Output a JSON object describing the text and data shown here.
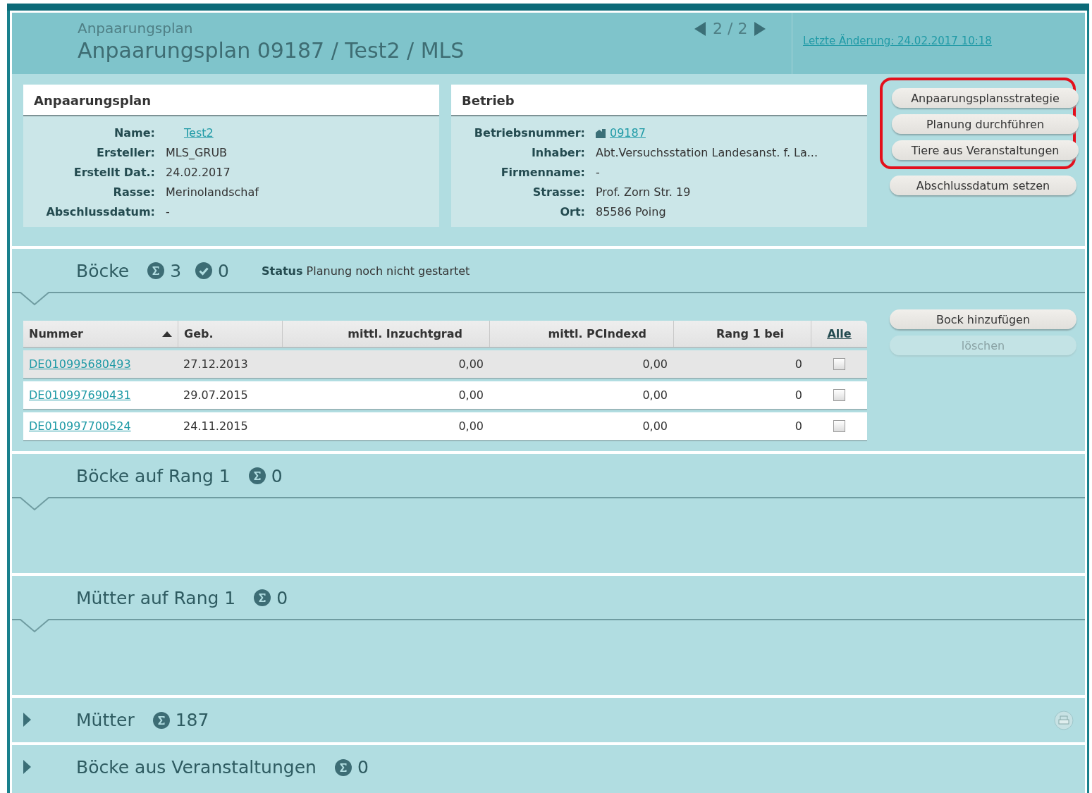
{
  "header": {
    "subtitle": "Anpaarungsplan",
    "title": "Anpaarungsplan 09187 / Test2 / MLS",
    "pager": "2 / 2",
    "last_change": "Letzte Änderung: 24.02.2017 10:18"
  },
  "cards": [
    {
      "title": "Anpaarungsplan",
      "fields": [
        {
          "label": "Name:",
          "value": "Test2",
          "kind": "link"
        },
        {
          "label": "Ersteller:",
          "value": "MLS_GRUB",
          "kind": "text"
        },
        {
          "label": "Erstellt Dat.:",
          "value": "24.02.2017",
          "kind": "text"
        },
        {
          "label": "Rasse:",
          "value": "Merinolandschaf",
          "kind": "text"
        },
        {
          "label": "Abschlussdatum:",
          "value": "-",
          "kind": "text"
        }
      ]
    },
    {
      "title": "Betrieb",
      "fields": [
        {
          "label": "Betriebsnummer:",
          "value": "09187",
          "kind": "farm_link"
        },
        {
          "label": "Inhaber:",
          "value": "Abt.Versuchsstation Landesanst. f. La...",
          "kind": "text"
        },
        {
          "label": "Firmenname:",
          "value": "-",
          "kind": "text"
        },
        {
          "label": "Strasse:",
          "value": "Prof. Zorn Str. 19",
          "kind": "text"
        },
        {
          "label": "Ort:",
          "value": "85586 Poing",
          "kind": "text"
        }
      ]
    }
  ],
  "actions": [
    {
      "label": "Anpaarungsplansstrategie",
      "highlighted": true,
      "disabled": false
    },
    {
      "label": "Planung durchführen",
      "highlighted": true,
      "disabled": false
    },
    {
      "label": "Tiere aus Veranstaltungen",
      "highlighted": true,
      "disabled": false
    },
    {
      "label": "Abschlussdatum setzen",
      "highlighted": false,
      "disabled": false
    }
  ],
  "sections": [
    {
      "title": "Böcke",
      "expanded": true,
      "printable": false,
      "counts": [
        {
          "kind": "total",
          "value": "3"
        },
        {
          "kind": "done",
          "value": "0"
        }
      ],
      "status": "**Status** Planung noch nicht gestartet",
      "table": {
        "columns": [
          {
            "label": "Nummer",
            "kind": "text",
            "sorted": true
          },
          {
            "label": "Geb.",
            "kind": "text",
            "sorted": false
          },
          {
            "label": "mittl. Inzuchtgrad",
            "kind": "number",
            "sorted": false
          },
          {
            "label": "mittl. PCIndexd",
            "kind": "number",
            "sorted": false
          },
          {
            "label": "Rang 1 bei",
            "kind": "number",
            "sorted": false
          },
          {
            "label": "Alle",
            "kind": "link",
            "sorted": false
          }
        ],
        "rows": [
          {
            "selected": true,
            "checked": false,
            "cells": [
              "DE010995680493",
              "27.12.2013",
              "0,00",
              "0,00",
              "0"
            ]
          },
          {
            "selected": false,
            "checked": false,
            "cells": [
              "DE010997690431",
              "29.07.2015",
              "0,00",
              "0,00",
              "0"
            ]
          },
          {
            "selected": false,
            "checked": false,
            "cells": [
              "DE010997700524",
              "24.11.2015",
              "0,00",
              "0,00",
              "0"
            ]
          }
        ]
      },
      "buttons": [
        {
          "label": "Bock hinzufügen",
          "disabled": false
        },
        {
          "label": "löschen",
          "disabled": true
        }
      ]
    },
    {
      "title": "Böcke auf Rang 1",
      "expanded": true,
      "printable": false,
      "counts": [
        {
          "kind": "total",
          "value": "0"
        }
      ]
    },
    {
      "title": "Mütter auf Rang 1",
      "expanded": true,
      "printable": false,
      "counts": [
        {
          "kind": "total",
          "value": "0"
        }
      ]
    },
    {
      "title": "Mütter",
      "expanded": false,
      "printable": true,
      "counts": [
        {
          "kind": "total",
          "value": "187"
        }
      ]
    },
    {
      "title": "Böcke aus Veranstaltungen",
      "expanded": false,
      "printable": false,
      "counts": [
        {
          "kind": "total",
          "value": "0"
        }
      ]
    }
  ]
}
